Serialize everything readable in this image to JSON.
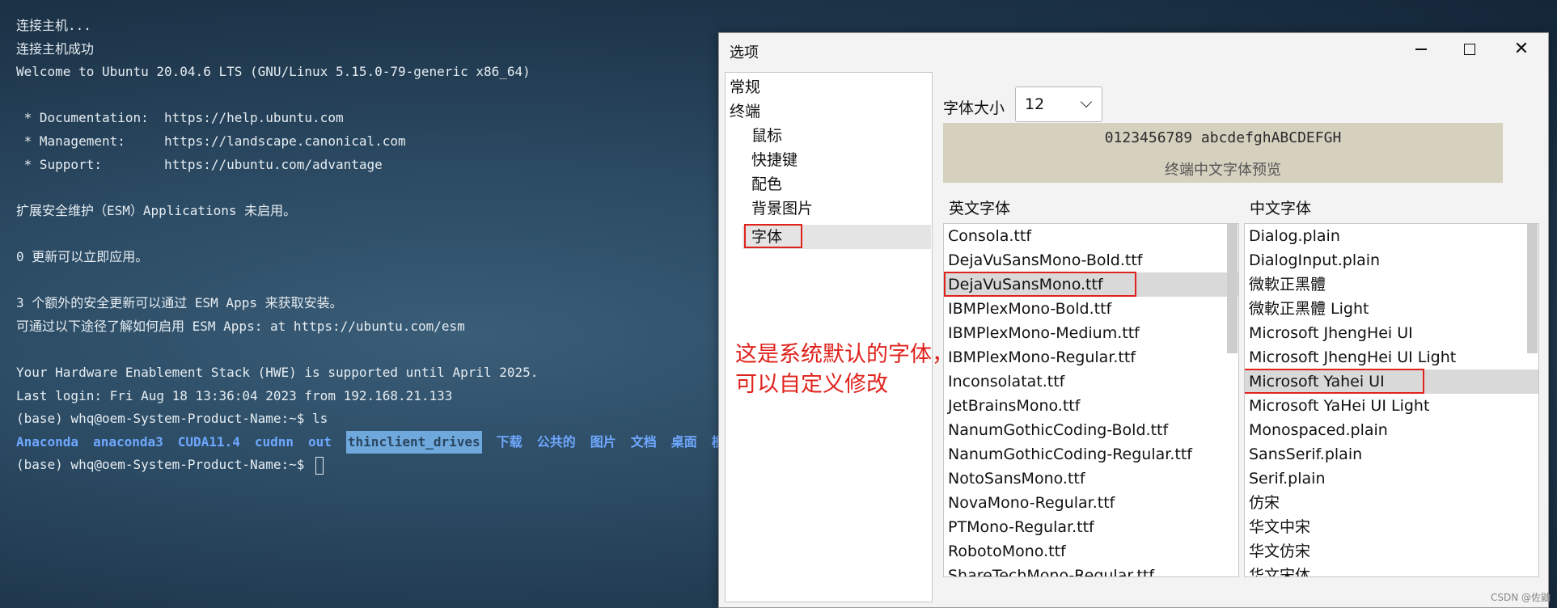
{
  "terminal": {
    "lines": [
      "连接主机...",
      "连接主机成功",
      "Welcome to Ubuntu 20.04.6 LTS (GNU/Linux 5.15.0-79-generic x86_64)",
      "",
      " * Documentation:  https://help.ubuntu.com",
      " * Management:     https://landscape.canonical.com",
      " * Support:        https://ubuntu.com/advantage",
      "",
      "扩展安全维护（ESM）Applications 未启用。",
      "",
      "0 更新可以立即应用。",
      "",
      "3 个额外的安全更新可以通过 ESM Apps 来获取安装。",
      "可通过以下途径了解如何启用 ESM Apps: at https://ubuntu.com/esm",
      "",
      "Your Hardware Enablement Stack (HWE) is supported until April 2025.",
      "Last login: Fri Aug 18 13:36:04 2023 from 192.168.21.133",
      "(base) whq@oem-System-Product-Name:~$ ls"
    ],
    "ls_items": [
      "Anaconda",
      "anaconda3",
      "CUDA11.4",
      "cudnn",
      "out",
      "thinclient_drives",
      "下载",
      "公共的",
      "图片",
      "文档",
      "桌面",
      "模"
    ],
    "prompt": "(base) whq@oem-System-Product-Name:~$ "
  },
  "dialog": {
    "title": "选项",
    "controls": {
      "minimize": "─",
      "maximize": "☐",
      "close": "✕"
    },
    "categories": [
      {
        "label": "常规"
      },
      {
        "label": "终端"
      },
      {
        "label": "鼠标"
      },
      {
        "label": "快捷键"
      },
      {
        "label": "配色"
      },
      {
        "label": "背景图片"
      },
      {
        "label": "字体"
      }
    ],
    "selected_category": "字体",
    "font_size_label": "字体大小",
    "font_size_value": "12",
    "preview_sample": "0123456789 abcdefghABCDEFGH",
    "preview_caption": "终端中文字体预览",
    "english_font_label": "英文字体",
    "chinese_font_label": "中文字体",
    "english_fonts": [
      "Consola.ttf",
      "DejaVuSansMono-Bold.ttf",
      "DejaVuSansMono.ttf",
      "IBMPlexMono-Bold.ttf",
      "IBMPlexMono-Medium.ttf",
      "IBMPlexMono-Regular.ttf",
      "Inconsolatat.ttf",
      "JetBrainsMono.ttf",
      "NanumGothicCoding-Bold.ttf",
      "NanumGothicCoding-Regular.ttf",
      "NotoSansMono.ttf",
      "NovaMono-Regular.ttf",
      "PTMono-Regular.ttf",
      "RobotoMono.ttf",
      "ShareTechMono-Regular.ttf"
    ],
    "english_selected": "DejaVuSansMono.ttf",
    "chinese_fonts": [
      "Dialog.plain",
      "DialogInput.plain",
      "微軟正黑體",
      "微軟正黑體 Light",
      "Microsoft JhengHei UI",
      "Microsoft JhengHei UI Light",
      "Microsoft Yahei UI",
      "Microsoft YaHei UI Light",
      "Monospaced.plain",
      "SansSerif.plain",
      "Serif.plain",
      "仿宋",
      "华文中宋",
      "华文仿宋",
      "华文宋体"
    ],
    "chinese_selected": "Microsoft Yahei UI",
    "annotation": [
      "这是系统默认的字体，",
      "可以自定义修改"
    ]
  },
  "watermark": "CSDN @佐鼬",
  "colors": {
    "annotation_red": "#e0221c",
    "ls_blue": "#6fa8ff",
    "preview_bg": "#d6d0bf"
  }
}
